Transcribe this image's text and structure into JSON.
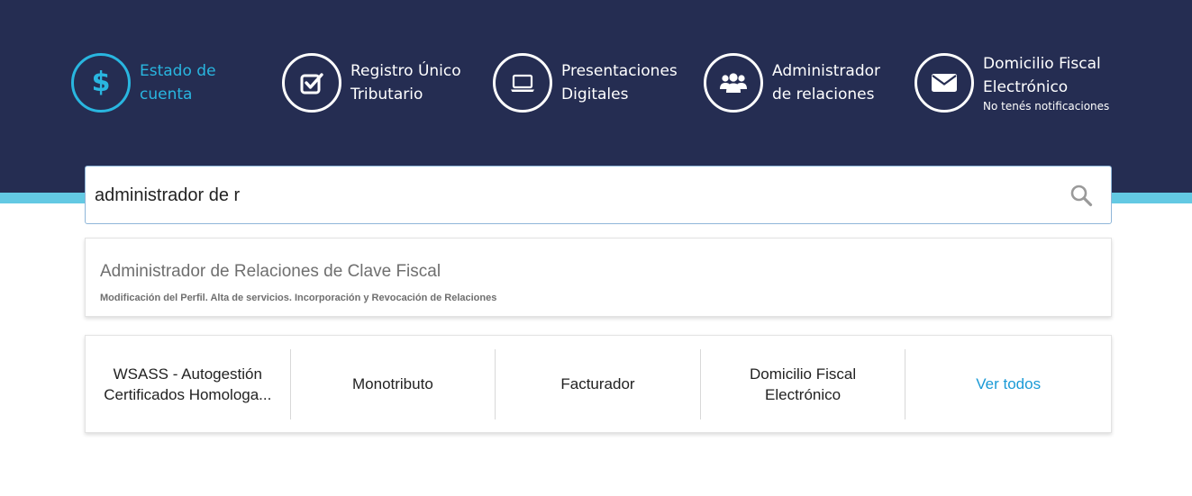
{
  "nav": {
    "items": [
      {
        "label": "Estado de\ncuenta",
        "sublabel": "",
        "icon": "dollar-icon",
        "active": true
      },
      {
        "label": "Registro Único\nTributario",
        "sublabel": "",
        "icon": "checkbox-icon",
        "active": false
      },
      {
        "label": "Presentaciones\nDigitales",
        "sublabel": "",
        "icon": "laptop-icon",
        "active": false
      },
      {
        "label": "Administrador\nde relaciones",
        "sublabel": "",
        "icon": "users-icon",
        "active": false
      },
      {
        "label": "Domicilio Fiscal\nElectrónico",
        "sublabel": "No tenés notificaciones",
        "icon": "envelope-icon",
        "active": false
      }
    ]
  },
  "search": {
    "value": "administrador de r",
    "placeholder": ""
  },
  "suggestion": {
    "title": "Administrador de Relaciones de Clave Fiscal",
    "description": "Modificación del Perfil. Alta de servicios. Incorporación y Revocación de Relaciones"
  },
  "quick_links": [
    "WSASS - Autogestión Certificados Homologa...",
    "Monotributo",
    "Facturador",
    "Domicilio Fiscal Electrónico",
    "Ver todos"
  ],
  "colors": {
    "header": "#252d52",
    "accent": "#29b6e0",
    "stripe": "#63c9e3",
    "link": "#1a9ad6"
  }
}
